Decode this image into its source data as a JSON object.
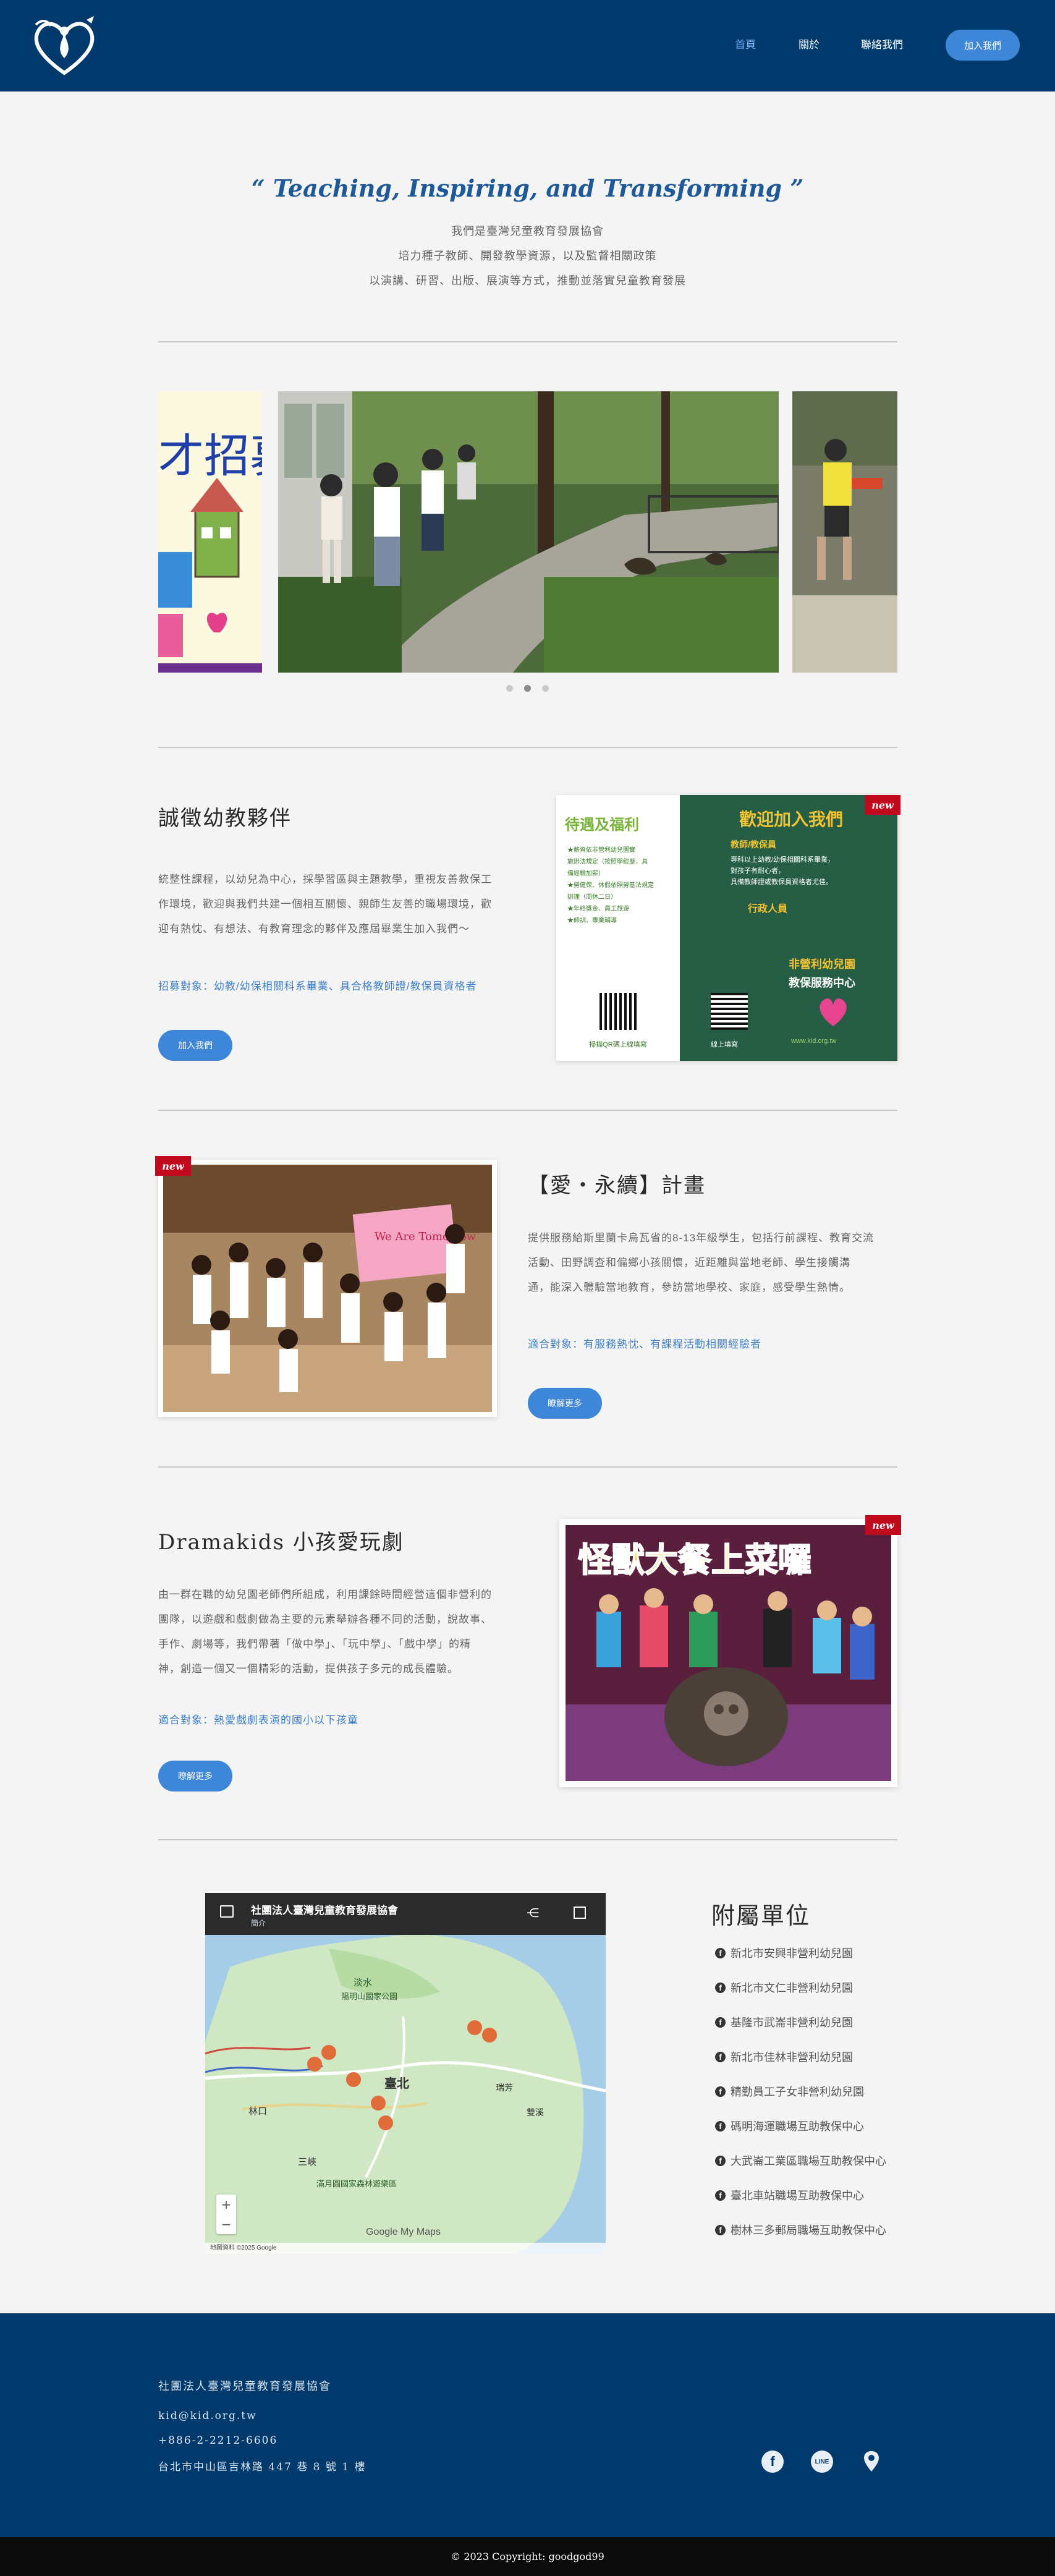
{
  "nav": {
    "items": [
      "首頁",
      "關於",
      "聯絡我們"
    ],
    "join_label": "加入我們"
  },
  "hero": {
    "quote": "“ Teaching, Inspiring, and Transforming ”",
    "lines": [
      "我們是臺灣兒童教育發展協會",
      "培力種子教師、開發教學資源，以及監督相關政策",
      "以演講、研習、出版、展演等方式，推動並落實兒童教育發展"
    ]
  },
  "carousel": {
    "slide_count": 3,
    "active_index": 1,
    "left_poster_text": "才招募"
  },
  "sections": [
    {
      "title": "誠徵幼教夥伴",
      "body": [
        "統整性課程，以幼兒為中心，採學習區與主題教學，重視友善教保工",
        "作環境，歡迎與我們共建一個相互關懷、親師生友善的職場環境，歡",
        "迎有熱忱、有想法、有教育理念的夥伴及應屆畢業生加入我們～"
      ],
      "target": "招募對象：幼教/幼保相關科系畢業、具合格教師證/教保員資格者",
      "button": "加入我們",
      "badge": "new",
      "poster": {
        "left_heading": "待遇及福利",
        "left_lines": [
          "★薪資依非營利幼兒園實",
          "施辦法規定（按照學經歷，具",
          "備經驗加薪）",
          "★勞健保、休假依照勞基法規定",
          "辦理（周休二日）",
          "★年終獎金、員工旅遊",
          "★師訓、專業輔導"
        ],
        "right_heading": "歡迎加入我們",
        "right_sub": "教師/教保員",
        "right_lines": [
          "專科以上幼教/幼保相關科系畢業，",
          "對孩子有耐心者，",
          "具備教師證或教保員資格者尤佳。"
        ],
        "right_role": "行政人員",
        "right_org1": "非營利幼兒園",
        "right_org2": "教保服務中心",
        "right_site": "www.kid.org.tw",
        "bottom_left": "掃描QR碼上線填寫",
        "bottom_right": "線上填寫"
      }
    },
    {
      "title": "【愛‧永續】計畫",
      "body": [
        "提供服務給斯里蘭卡烏瓦省的8-13年級學生，包括行前課程、教育交流",
        "活動、田野調查和偏鄉小孩關懷，近距離與當地老師、學生接觸溝",
        "通，能深入體驗當地教育，參訪當地學校、家庭，感受學生熱情。"
      ],
      "target": "適合對象：有服務熱忱、有課程活動相關經驗者",
      "button": "瞭解更多",
      "badge": "new",
      "photo_sign": "We Are Tomorrow"
    },
    {
      "title": "Dramakids 小孩愛玩劇",
      "body": [
        "由一群在職的幼兒園老師們所組成，利用課餘時間經營這個非營利的",
        "團隊，以遊戲和戲劇做為主要的元素舉辦各種不同的活動，說故事、",
        "手作、劇場等，我們帶著「做中學」、「玩中學」、「戲中學」的精",
        "神，創造一個又一個精彩的活動，提供孩子多元的成長體驗。"
      ],
      "target": "適合對象：熱愛戲劇表演的國小以下孩童",
      "button": "瞭解更多",
      "badge": "new",
      "poster_title": "怪獸大餐上菜囉"
    }
  ],
  "map": {
    "title": "社團法人臺灣兒童教育發展協會",
    "sub": "簡介",
    "labels": [
      "淡水",
      "陽明山國家公園",
      "臺北",
      "林口",
      "三峽",
      "滿月圓國家森林遊樂區",
      "雙溪",
      "瑞芳"
    ],
    "footer_text": "地圖資料 ©2025 Google",
    "brand": "Google My Maps"
  },
  "affiliates": {
    "title": "附屬單位",
    "items": [
      "新北市安興非營利幼兒園",
      "新北市文仁非營利幼兒園",
      "基隆市武崙非營利幼兒園",
      "新北市佳林非營利幼兒園",
      "精勤員工子女非營利幼兒園",
      "碼明海運職場互助教保中心",
      "大武崙工業區職場互助教保中心",
      "臺北車站職場互助教保中心",
      "樹林三多郵局職場互助教保中心"
    ]
  },
  "footer": {
    "org": "社團法人臺灣兒童教育發展協會",
    "email": "kid@kid.org.tw",
    "phone": "+886-2-2212-6606",
    "address": "台北市中山區吉林路 447 巷 8 號 1 樓",
    "copyright": "© 2023 Copyright: goodgod99",
    "line_label": "LINE"
  }
}
